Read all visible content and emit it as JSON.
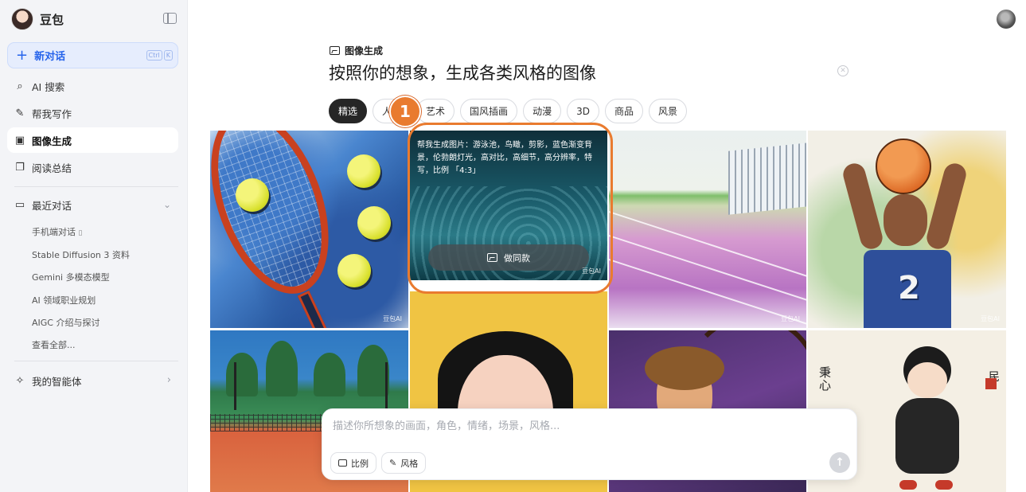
{
  "sidebar": {
    "brand": "豆包",
    "new_chat": "新对话",
    "shortcut": [
      "Ctrl",
      "K"
    ],
    "nav": [
      {
        "label": "AI 搜索",
        "icon": "search-icon"
      },
      {
        "label": "帮我写作",
        "icon": "pen-icon"
      },
      {
        "label": "图像生成",
        "icon": "image-icon",
        "active": true
      },
      {
        "label": "阅读总结",
        "icon": "book-icon"
      }
    ],
    "recent_title": "最近对话",
    "recent": [
      "手机端对话",
      "Stable Diffusion 3 资料",
      "Gemini 多模态模型",
      "AI 领域职业规划",
      "AIGC 介绍与探讨",
      "查看全部..."
    ],
    "agents": "我的智能体"
  },
  "main": {
    "section_label": "图像生成",
    "headline": "按照你的想象，生成各类风格的图像",
    "chips": [
      "精选",
      "人像",
      "艺术",
      "国风插画",
      "动漫",
      "3D",
      "商品",
      "风景"
    ],
    "active_chip": "精选",
    "annotation_badge": "1",
    "hover_card": {
      "prompt": "帮我生成图片：游泳池，鸟瞰，剪影，蓝色渐变背景，伦勃朗灯光，高对比，高细节，高分辨率，特写，比例 「4:3」",
      "button": "做同款"
    },
    "watermark": "豆包AI"
  },
  "composer": {
    "placeholder": "描述你所想象的画面，角色，情绪，场景，风格...",
    "ratio_label": "比例",
    "style_label": "风格"
  },
  "colors": {
    "accent_blue": "#2563eb",
    "highlight_orange": "#e97b2f",
    "sidebar_bg": "#f3f4f7",
    "active_chip": "#262626"
  }
}
